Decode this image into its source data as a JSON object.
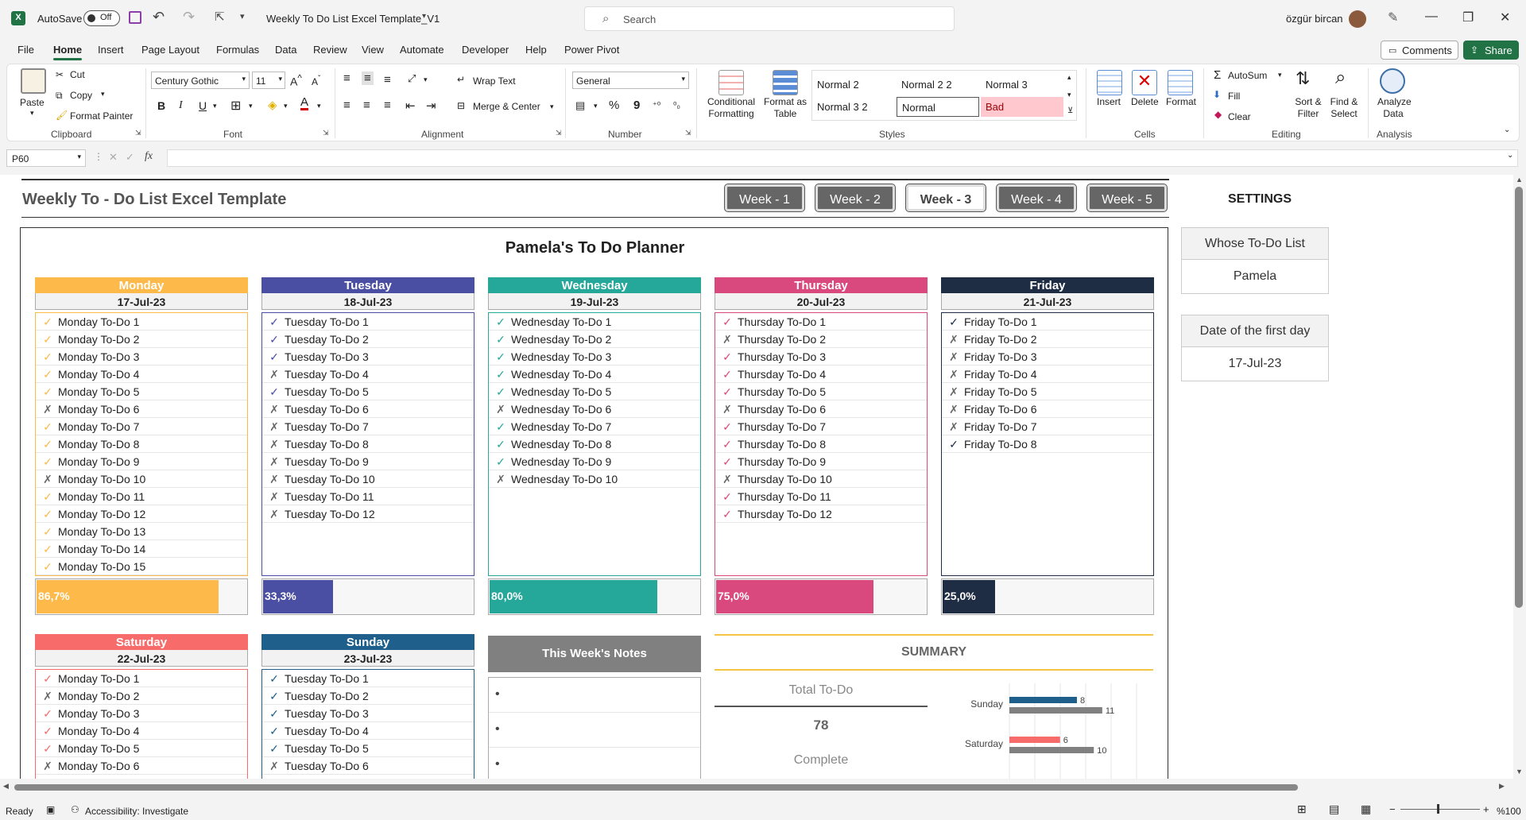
{
  "titlebar": {
    "autosave": "AutoSave",
    "toggle": "Off",
    "filename": "Weekly To Do List Excel Template_V1",
    "search_placeholder": "Search",
    "user": "özgür bircan"
  },
  "menu": [
    "File",
    "Home",
    "Insert",
    "Page Layout",
    "Formulas",
    "Data",
    "Review",
    "View",
    "Automate",
    "Developer",
    "Help",
    "Power Pivot"
  ],
  "top_buttons": {
    "comments": "Comments",
    "share": "Share"
  },
  "ribbon": {
    "clipboard": {
      "paste": "Paste",
      "cut": "Cut",
      "copy": "Copy",
      "format_painter": "Format Painter",
      "group": "Clipboard"
    },
    "font": {
      "name": "Century Gothic",
      "size": "11",
      "bold": "B",
      "italic": "I",
      "underline": "U",
      "group": "Font"
    },
    "alignment": {
      "wrap": "Wrap Text",
      "merge": "Merge & Center",
      "group": "Alignment"
    },
    "number": {
      "format": "General",
      "percent": "%",
      "comma": "9",
      "group": "Number"
    },
    "styles": {
      "conditional": "Conditional Formatting",
      "format_table": "Format as Table",
      "cells": [
        "Normal 2",
        "Normal 2 2",
        "Normal 3",
        "Normal 3 2",
        "Normal",
        "Bad"
      ],
      "group": "Styles"
    },
    "cells": {
      "insert": "Insert",
      "delete": "Delete",
      "format": "Format",
      "group": "Cells"
    },
    "editing": {
      "autosum": "AutoSum",
      "fill": "Fill",
      "clear": "Clear",
      "sort": "Sort & Filter",
      "find": "Find & Select",
      "group": "Editing"
    },
    "analysis": {
      "analyze": "Analyze Data",
      "group": "Analysis"
    }
  },
  "formula_bar": {
    "namebox": "P60",
    "fx": "fx"
  },
  "sheet": {
    "title": "Weekly To - Do List Excel Template",
    "weeks": [
      "Week - 1",
      "Week - 2",
      "Week - 3",
      "Week - 4",
      "Week - 5"
    ],
    "active_week": 2,
    "settings": "SETTINGS",
    "whose_label": "Whose To-Do List",
    "whose_value": "Pamela",
    "date_label": "Date of the first day",
    "date_value": "17-Jul-23",
    "planner_title": "Pamela's To Do Planner",
    "notes_title": "This Week's Notes",
    "summary_title": "SUMMARY",
    "total_label": "Total To-Do",
    "total_value": "78",
    "complete_label": "Complete"
  },
  "days": [
    {
      "name": "Monday",
      "date": "17-Jul-23",
      "color": "#FDB94A",
      "pct": "86,7%",
      "fill": 0.867,
      "tasks": [
        [
          "Monday To-Do 1",
          "c"
        ],
        [
          "Monday To-Do 2",
          "c"
        ],
        [
          "Monday To-Do 3",
          "c"
        ],
        [
          "Monday To-Do 4",
          "c"
        ],
        [
          "Monday To-Do 5",
          "c"
        ],
        [
          "Monday To-Do 6",
          "x"
        ],
        [
          "Monday To-Do 7",
          "c"
        ],
        [
          "Monday To-Do 8",
          "c"
        ],
        [
          "Monday To-Do 9",
          "c"
        ],
        [
          "Monday To-Do 10",
          "x"
        ],
        [
          "Monday To-Do 11",
          "c"
        ],
        [
          "Monday To-Do 12",
          "c"
        ],
        [
          "Monday To-Do 13",
          "c"
        ],
        [
          "Monday To-Do 14",
          "c"
        ],
        [
          "Monday To-Do 15",
          "c"
        ]
      ]
    },
    {
      "name": "Tuesday",
      "date": "18-Jul-23",
      "color": "#4B4FA3",
      "pct": "33,3%",
      "fill": 0.333,
      "tasks": [
        [
          "Tuesday To-Do 1",
          "c"
        ],
        [
          "Tuesday To-Do 2",
          "c"
        ],
        [
          "Tuesday To-Do 3",
          "c"
        ],
        [
          "Tuesday To-Do 4",
          "x"
        ],
        [
          "Tuesday To-Do 5",
          "c"
        ],
        [
          "Tuesday To-Do 6",
          "x"
        ],
        [
          "Tuesday To-Do 7",
          "x"
        ],
        [
          "Tuesday To-Do 8",
          "x"
        ],
        [
          "Tuesday To-Do 9",
          "x"
        ],
        [
          "Tuesday To-Do 10",
          "x"
        ],
        [
          "Tuesday To-Do 11",
          "x"
        ],
        [
          "Tuesday To-Do 12",
          "x"
        ]
      ]
    },
    {
      "name": "Wednesday",
      "date": "19-Jul-23",
      "color": "#25A79A",
      "pct": "80,0%",
      "fill": 0.8,
      "tasks": [
        [
          "Wednesday To-Do 1",
          "c"
        ],
        [
          "Wednesday To-Do 2",
          "c"
        ],
        [
          "Wednesday To-Do 3",
          "c"
        ],
        [
          "Wednesday To-Do 4",
          "c"
        ],
        [
          "Wednesday To-Do 5",
          "c"
        ],
        [
          "Wednesday To-Do 6",
          "x"
        ],
        [
          "Wednesday To-Do 7",
          "c"
        ],
        [
          "Wednesday To-Do 8",
          "c"
        ],
        [
          "Wednesday To-Do 9",
          "c"
        ],
        [
          "Wednesday To-Do 10",
          "x"
        ]
      ]
    },
    {
      "name": "Thursday",
      "date": "20-Jul-23",
      "color": "#D9497E",
      "pct": "75,0%",
      "fill": 0.75,
      "tasks": [
        [
          "Thursday To-Do 1",
          "c"
        ],
        [
          "Thursday To-Do 2",
          "x"
        ],
        [
          "Thursday To-Do 3",
          "c"
        ],
        [
          "Thursday To-Do 4",
          "c"
        ],
        [
          "Thursday To-Do 5",
          "c"
        ],
        [
          "Thursday To-Do 6",
          "x"
        ],
        [
          "Thursday To-Do 7",
          "c"
        ],
        [
          "Thursday To-Do 8",
          "c"
        ],
        [
          "Thursday To-Do 9",
          "c"
        ],
        [
          "Thursday To-Do 10",
          "x"
        ],
        [
          "Thursday To-Do 11",
          "c"
        ],
        [
          "Thursday To-Do 12",
          "c"
        ]
      ]
    },
    {
      "name": "Friday",
      "date": "21-Jul-23",
      "color": "#1F2D44",
      "pct": "25,0%",
      "fill": 0.25,
      "tasks": [
        [
          "Friday To-Do 1",
          "c"
        ],
        [
          "Friday To-Do 2",
          "x"
        ],
        [
          "Friday To-Do 3",
          "x"
        ],
        [
          "Friday To-Do 4",
          "x"
        ],
        [
          "Friday To-Do 5",
          "x"
        ],
        [
          "Friday To-Do 6",
          "x"
        ],
        [
          "Friday To-Do 7",
          "x"
        ],
        [
          "Friday To-Do 8",
          "c"
        ]
      ]
    },
    {
      "name": "Saturday",
      "date": "22-Jul-23",
      "color": "#F76B6B",
      "pct": "",
      "fill": 0,
      "tasks": [
        [
          "Monday To-Do 1",
          "c"
        ],
        [
          "Monday To-Do 2",
          "x"
        ],
        [
          "Monday To-Do 3",
          "c"
        ],
        [
          "Monday To-Do 4",
          "c"
        ],
        [
          "Monday To-Do 5",
          "c"
        ],
        [
          "Monday To-Do 6",
          "x"
        ]
      ]
    },
    {
      "name": "Sunday",
      "date": "23-Jul-23",
      "color": "#1F5F8B",
      "pct": "",
      "fill": 0,
      "tasks": [
        [
          "Tuesday To-Do 1",
          "c"
        ],
        [
          "Tuesday To-Do 2",
          "c"
        ],
        [
          "Tuesday To-Do 3",
          "c"
        ],
        [
          "Tuesday To-Do 4",
          "c"
        ],
        [
          "Tuesday To-Do 5",
          "c"
        ],
        [
          "Tuesday To-Do 6",
          "x"
        ]
      ]
    }
  ],
  "chart_data": {
    "type": "bar",
    "categories": [
      "Sunday",
      "Saturday"
    ],
    "series": [
      {
        "values": [
          8,
          6
        ]
      },
      {
        "values": [
          11,
          10
        ]
      }
    ],
    "xlim": [
      0,
      16
    ]
  },
  "statusbar": {
    "ready": "Ready",
    "accessibility": "Accessibility: Investigate",
    "zoom": "%100"
  }
}
